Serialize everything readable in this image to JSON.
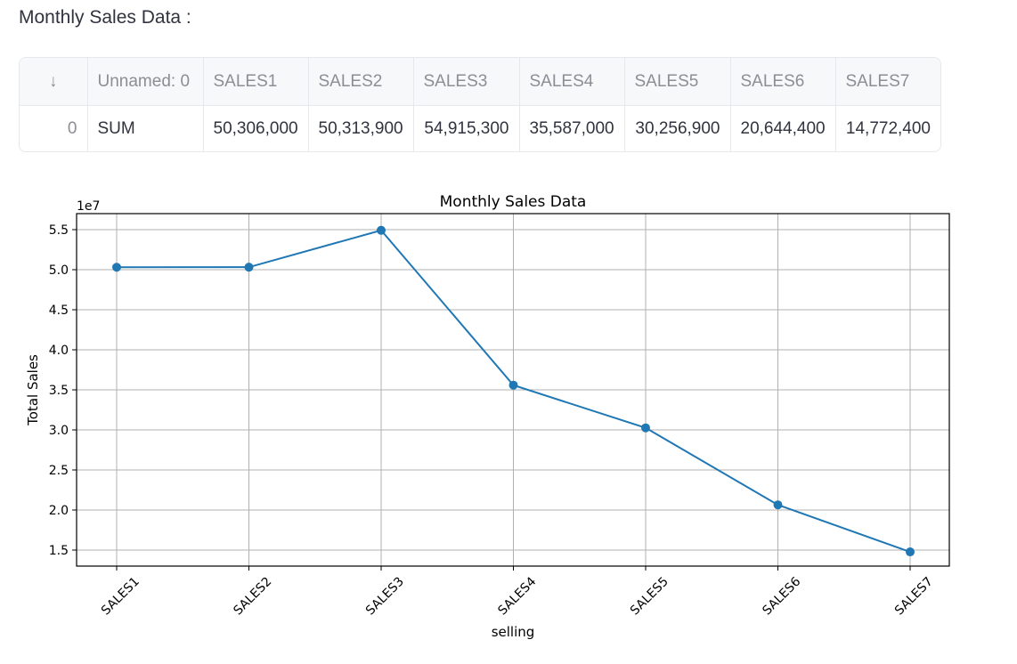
{
  "page": {
    "heading": "Monthly Sales Data :"
  },
  "table": {
    "index_header_icon": "arrow-down-icon",
    "index_header_glyph": "↓",
    "columns": [
      "Unnamed: 0",
      "SALES1",
      "SALES2",
      "SALES3",
      "SALES4",
      "SALES5",
      "SALES6",
      "SALES7"
    ],
    "rows": [
      {
        "index": "0",
        "cells": [
          "SUM",
          "50,306,000",
          "50,313,900",
          "54,915,300",
          "35,587,000",
          "30,256,900",
          "20,644,400",
          "14,772,400"
        ]
      }
    ]
  },
  "chart_data": {
    "type": "line",
    "title": "Monthly Sales Data",
    "xlabel": "selling",
    "ylabel": "Total Sales",
    "y_offset_label": "1e7",
    "categories": [
      "SALES1",
      "SALES2",
      "SALES3",
      "SALES4",
      "SALES5",
      "SALES6",
      "SALES7"
    ],
    "values": [
      50306000,
      50313900,
      54915300,
      35587000,
      30256900,
      20644400,
      14772400
    ],
    "ylim": [
      13000000,
      57000000
    ],
    "yticks": [
      1.5,
      2.0,
      2.5,
      3.0,
      3.5,
      4.0,
      4.5,
      5.0,
      5.5
    ],
    "ytick_scale": 10000000,
    "grid": true,
    "line_color": "#1f77b4",
    "marker": "circle"
  }
}
